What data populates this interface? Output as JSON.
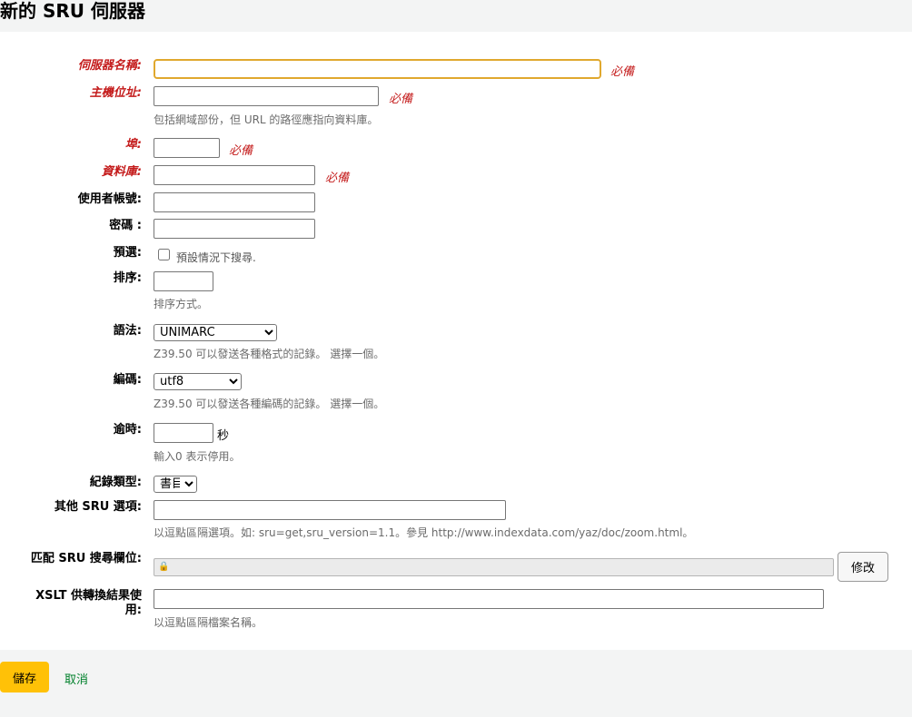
{
  "page": {
    "title": "新的 SRU 伺服器"
  },
  "required_tag": "必備",
  "fields": {
    "servername": {
      "label": "伺服器名稱:",
      "value": ""
    },
    "host": {
      "label": "主機位址:",
      "value": "",
      "hint": "包括網域部份，但 URL 的路徑應指向資料庫。"
    },
    "port": {
      "label": "埠:",
      "value": ""
    },
    "database": {
      "label": "資料庫:",
      "value": ""
    },
    "userid": {
      "label": "使用者帳號:",
      "value": ""
    },
    "password": {
      "label": "密碼 :",
      "value": ""
    },
    "checked": {
      "label": "預選:",
      "checkbox_label": "預設情況下搜尋.",
      "checked": false
    },
    "rank": {
      "label": "排序:",
      "value": "",
      "hint": "排序方式。"
    },
    "syntax": {
      "label": "語法:",
      "selected": "UNIMARC",
      "hint": "Z39.50 可以發送各種格式的記錄。 選擇一個。"
    },
    "encoding": {
      "label": "編碼:",
      "selected": "utf8",
      "hint": "Z39.50 可以發送各種編碼的記錄。 選擇一個。"
    },
    "timeout": {
      "label": "逾時:",
      "value": "",
      "unit": "秒",
      "hint": "輸入0 表示停用。"
    },
    "recordtype": {
      "label": "紀錄類型:",
      "selected": "書目"
    },
    "sru_options": {
      "label": "其他 SRU 選項:",
      "value": "",
      "hint": "以逗點區隔選項。如: sru=get,sru_version=1.1。參見 http://www.indexdata.com/yaz/doc/zoom.html。"
    },
    "sru_fields": {
      "label": "匹配 SRU 搜尋欄位:",
      "value": "",
      "lock_icon": "lock-icon",
      "modify_label": "修改"
    },
    "xslt": {
      "label": "XSLT 供轉換結果使用:",
      "value": "",
      "hint": "以逗點區隔檔案名稱。"
    }
  },
  "actions": {
    "save_label": "儲存",
    "cancel_label": "取消"
  },
  "colors": {
    "required": "#c41b1b",
    "save_button": "#ffc107",
    "cancel_link": "#00802b",
    "focus_border": "#e0a82e"
  }
}
